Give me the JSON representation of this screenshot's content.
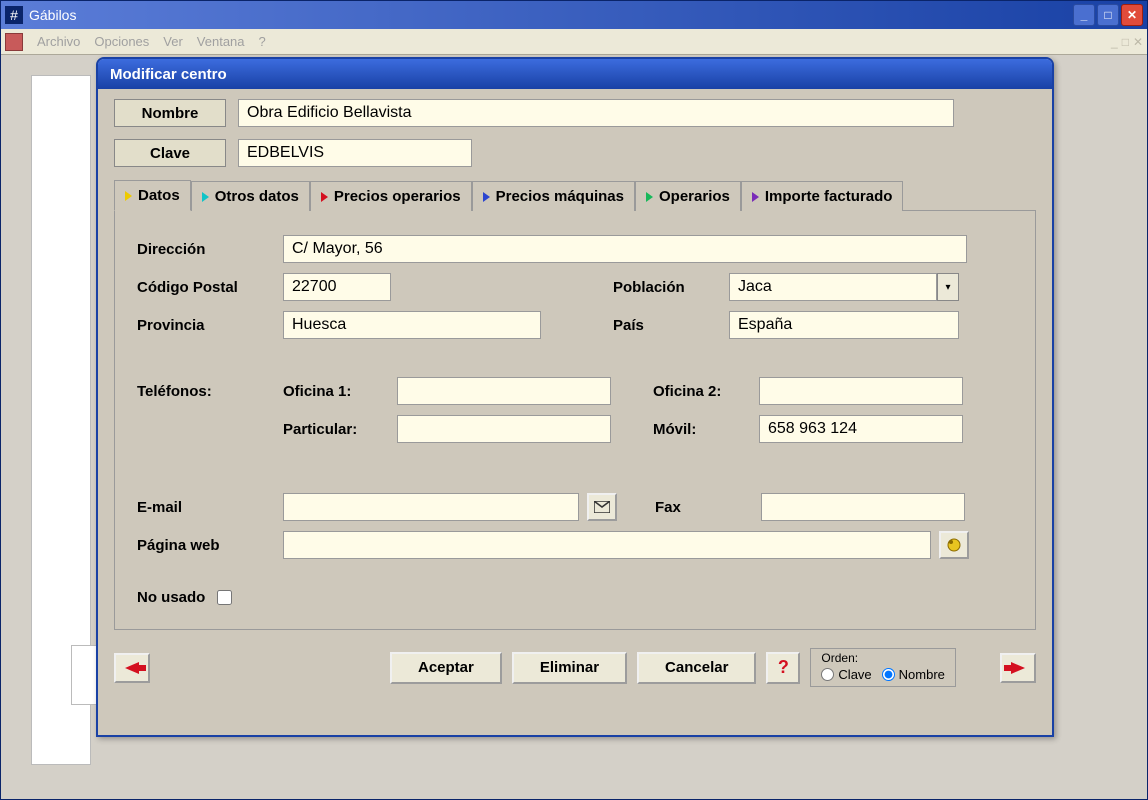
{
  "app": {
    "title": "Gábilos"
  },
  "menu": {
    "archivo": "Archivo",
    "opciones": "Opciones",
    "ver": "Ver",
    "ventana": "Ventana",
    "help": "?"
  },
  "dialog": {
    "title": "Modificar centro"
  },
  "header": {
    "nombre_label": "Nombre",
    "nombre_value": "Obra Edificio Bellavista",
    "clave_label": "Clave",
    "clave_value": "EDBELVIS"
  },
  "tabs": {
    "datos": "Datos",
    "otros": "Otros datos",
    "precios_op": "Precios operarios",
    "precios_maq": "Precios máquinas",
    "operarios": "Operarios",
    "importe": "Importe facturado"
  },
  "form": {
    "direccion_label": "Dirección",
    "direccion_value": "C/ Mayor, 56",
    "cp_label": "Código Postal",
    "cp_value": "22700",
    "poblacion_label": "Población",
    "poblacion_value": "Jaca",
    "provincia_label": "Provincia",
    "provincia_value": "Huesca",
    "pais_label": "País",
    "pais_value": "España",
    "telefonos_label": "Teléfonos:",
    "oficina1_label": "Oficina 1:",
    "oficina1_value": "",
    "oficina2_label": "Oficina 2:",
    "oficina2_value": "",
    "particular_label": "Particular:",
    "particular_value": "",
    "movil_label": "Móvil:",
    "movil_value": "658 963 124",
    "email_label": "E-mail",
    "email_value": "",
    "fax_label": "Fax",
    "fax_value": "",
    "web_label": "Página web",
    "web_value": "",
    "no_usado_label": "No usado"
  },
  "buttons": {
    "aceptar": "Aceptar",
    "eliminar": "Eliminar",
    "cancelar": "Cancelar",
    "help": "?"
  },
  "orden": {
    "label": "Orden:",
    "clave": "Clave",
    "nombre": "Nombre"
  }
}
